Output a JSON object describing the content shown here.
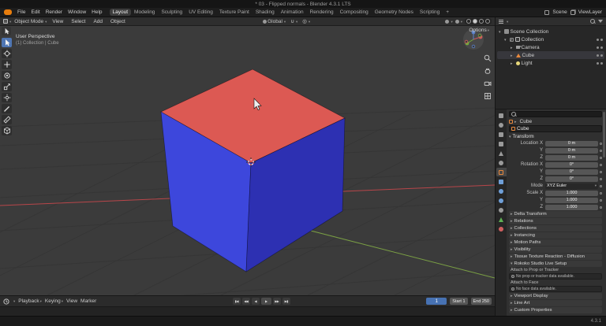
{
  "titlebar": {
    "title": "* 03 - Flipped normals - Blender 4.3.1 LTS"
  },
  "menubar": {
    "menus": [
      "File",
      "Edit",
      "Render",
      "Window",
      "Help"
    ],
    "workspaces": [
      "Layout",
      "Modeling",
      "Sculpting",
      "UV Editing",
      "Texture Paint",
      "Shading",
      "Animation",
      "Rendering",
      "Compositing",
      "Geometry Nodes",
      "Scripting",
      "+"
    ],
    "active_workspace": "Layout",
    "scene_label": "Scene",
    "view_layer_label": "ViewLayer"
  },
  "viewport": {
    "header": {
      "mode": "Object Mode",
      "menus": [
        "View",
        "Select",
        "Add",
        "Object"
      ],
      "orientation": "Global",
      "options_label": "Options"
    },
    "overlay": {
      "line1": "User Perspective",
      "line2": "(1) Collection | Cube"
    },
    "colors": {
      "cube_top": "#dc5953",
      "cube_left": "#3d47dc",
      "cube_right": "#2d30b2",
      "axis_x": "#b8464a",
      "axis_y": "#7a9f44"
    }
  },
  "outliner": {
    "rows": [
      {
        "label": "Scene Collection"
      },
      {
        "label": "Collection"
      },
      {
        "label": "Camera"
      },
      {
        "label": "Cube"
      },
      {
        "label": "Light"
      }
    ]
  },
  "properties": {
    "breadcrumb_object": "Cube",
    "name_field": "Cube",
    "transform": {
      "title": "Transform",
      "rows": [
        {
          "label": "Location X",
          "value": "0 m"
        },
        {
          "label": "Y",
          "value": "0 m"
        },
        {
          "label": "Z",
          "value": "0 m"
        },
        {
          "label": "Rotation X",
          "value": "0°"
        },
        {
          "label": "Y",
          "value": "0°"
        },
        {
          "label": "Z",
          "value": "0°"
        },
        {
          "label": "Mode",
          "value": "XYZ Euler"
        },
        {
          "label": "Scale X",
          "value": "1.000"
        },
        {
          "label": "Y",
          "value": "1.000"
        },
        {
          "label": "Z",
          "value": "1.000"
        }
      ]
    },
    "collapsed_sections": [
      "Delta Transform",
      "Relations",
      "Collections",
      "Instancing",
      "Motion Paths",
      "Visibility",
      "Tissue Texture Reaction - Diffusion"
    ],
    "rokoko": {
      "title": "Rokoko Studio Live Setup",
      "attach_prop_label": "Attach to Prop or Tracker",
      "attach_prop_empty": "No prop or tracker data available.",
      "attach_face_label": "Attach to Face",
      "attach_face_empty": "No face data available."
    },
    "bottom_sections": [
      "Viewport Display",
      "Line Art",
      "Custom Properties"
    ]
  },
  "timeline": {
    "menus": [
      "Playback",
      "Keying",
      "View",
      "Marker"
    ],
    "current_frame": "1",
    "start_field": "Start 1",
    "end_field": "End 250"
  },
  "statusbar": {
    "version": "4.3.1"
  },
  "icons": {
    "magnet": "∪",
    "proportional": "◎",
    "jump_start": "▮◀",
    "key_prev": "◀◀",
    "play_back": "◀",
    "play": "▶",
    "key_next": "▶▶",
    "jump_end": "▶▮"
  }
}
